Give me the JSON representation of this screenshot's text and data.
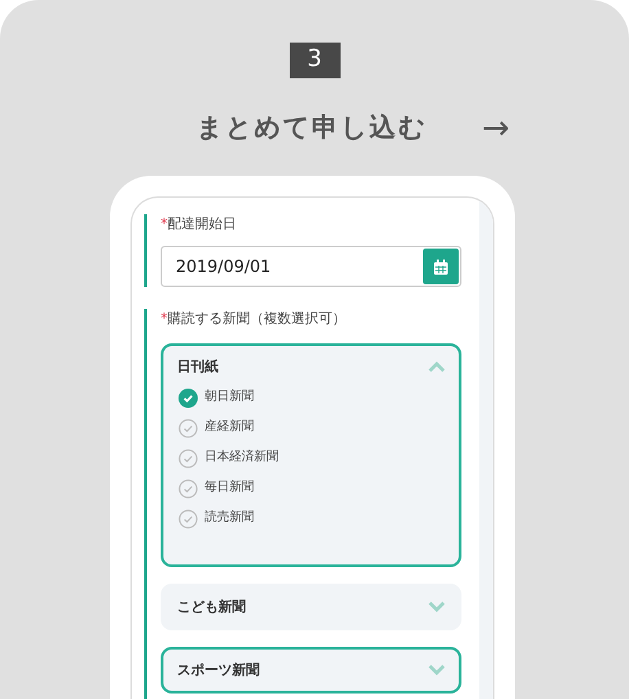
{
  "step": {
    "number": "3",
    "title": "まとめて申し込む",
    "arrow": "→"
  },
  "start_date": {
    "required_mark": "*",
    "label": "配達開始日",
    "value": "2019/09/01"
  },
  "newspapers": {
    "required_mark": "*",
    "label": "購読する新聞（複数選択可）",
    "groups": [
      {
        "title": "日刊紙",
        "expanded": true,
        "selected": true,
        "items": [
          {
            "label": "朝日新聞",
            "checked": true
          },
          {
            "label": "産経新聞",
            "checked": false
          },
          {
            "label": "日本経済新聞",
            "checked": false
          },
          {
            "label": "毎日新聞",
            "checked": false
          },
          {
            "label": "読売新聞",
            "checked": false
          }
        ]
      },
      {
        "title": "こども新聞",
        "expanded": false,
        "selected": false
      },
      {
        "title": "スポーツ新聞",
        "expanded": false,
        "selected": true
      }
    ]
  }
}
